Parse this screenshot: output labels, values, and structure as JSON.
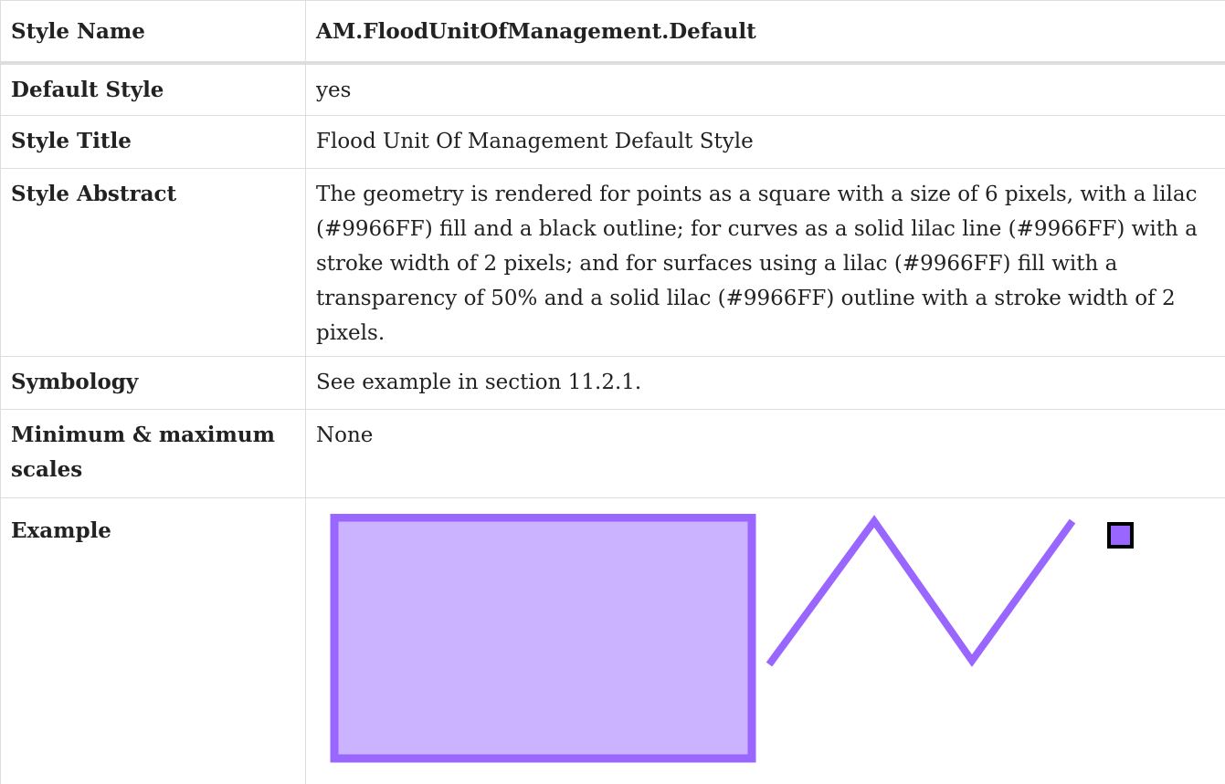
{
  "table": {
    "header": {
      "label": "Style Name",
      "value": "AM.FloodUnitOfManagement.Default"
    },
    "rows": [
      {
        "label": "Default Style",
        "value": "yes"
      },
      {
        "label": "Style Title",
        "value": "Flood Unit Of Management Default Style"
      },
      {
        "label": "Style Abstract",
        "value": "The geometry is rendered for points as a square with a size of 6 pixels, with a lilac (#9966FF) fill and a black outline; for curves as a solid lilac line (#9966FF) with a stroke width of 2 pixels; and for surfaces using a lilac (#9966FF) fill with a transparency of 50% and a solid lilac (#9966FF) outline with a stroke width of 2 pixels."
      },
      {
        "label": "Symbology",
        "value": "See example in section 11.2.1."
      },
      {
        "label": "Minimum & maximum scales",
        "value": "None"
      },
      {
        "label": "Example",
        "value": ""
      }
    ]
  },
  "example": {
    "lilac": "#9966FF",
    "lilac_fill_50": "#CCB3FF",
    "point_outline": "#000000"
  }
}
